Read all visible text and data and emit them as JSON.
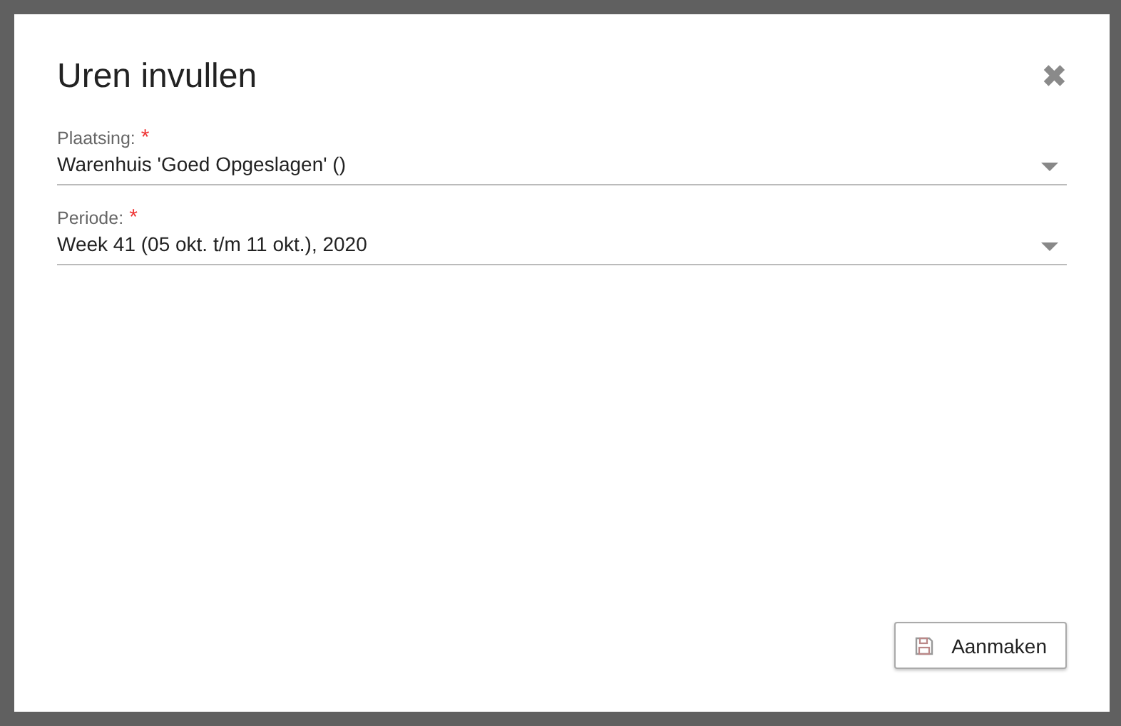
{
  "dialog": {
    "title": "Uren invullen",
    "close": "✖"
  },
  "fields": [
    {
      "label": "Plaatsing:",
      "required_mark": "*",
      "value": "Warenhuis 'Goed Opgeslagen' ()"
    },
    {
      "label": "Periode:",
      "required_mark": "*",
      "value": "Week 41 (05 okt. t/m 11 okt.), 2020"
    }
  ],
  "buttons": [
    {
      "label": "Aanmaken"
    }
  ]
}
